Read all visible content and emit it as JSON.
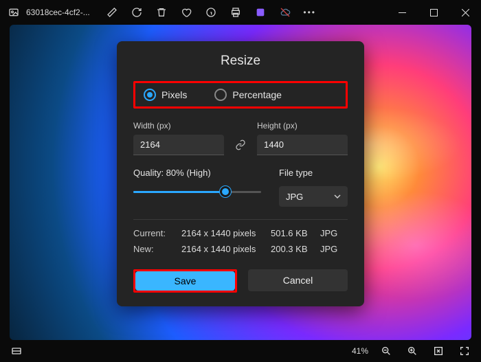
{
  "title": "63018cec-4cf2-...",
  "dialog": {
    "title": "Resize",
    "radio_pixels": "Pixels",
    "radio_percentage": "Percentage",
    "width_label": "Width (px)",
    "height_label": "Height (px)",
    "width_value": "2164",
    "height_value": "1440",
    "quality_label": "Quality: 80% (High)",
    "filetype_label": "File type",
    "filetype_value": "JPG",
    "current_label": "Current:",
    "new_label": "New:",
    "current_dims": "2164 x 1440 pixels",
    "new_dims": "2164 x 1440 pixels",
    "current_size": "501.6 KB",
    "new_size": "200.3 KB",
    "current_fmt": "JPG",
    "new_fmt": "JPG",
    "save": "Save",
    "cancel": "Cancel"
  },
  "status": {
    "zoom": "41%"
  }
}
